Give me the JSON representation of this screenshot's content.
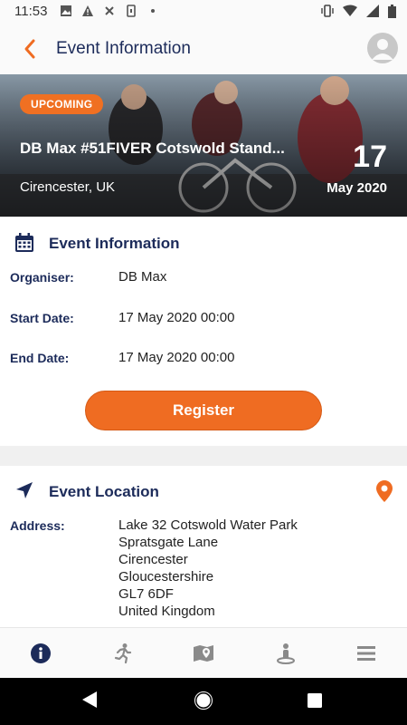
{
  "status_bar": {
    "time": "11:53"
  },
  "app_bar": {
    "title": "Event Information"
  },
  "hero": {
    "badge": "UPCOMING",
    "event_name": "DB Max #51FIVER Cotswold Stand...",
    "location": "Cirencester, UK",
    "day": "17",
    "month_year": "May 2020"
  },
  "event_info": {
    "heading": "Event Information",
    "rows": [
      {
        "label": "Organiser:",
        "value": "DB Max"
      },
      {
        "label": "Start Date:",
        "value": "17 May 2020 00:00"
      },
      {
        "label": "End Date:",
        "value": "17 May 2020 00:00"
      }
    ],
    "register_label": "Register"
  },
  "event_location": {
    "heading": "Event Location",
    "address_label": "Address:",
    "address_lines": [
      "Lake 32 Cotswold Water Park",
      "Spratsgate Lane",
      "Cirencester",
      "Gloucestershire",
      "GL7 6DF",
      "United Kingdom"
    ]
  },
  "colors": {
    "accent": "#ef6c22",
    "navy": "#1c2b5a"
  },
  "bottom_nav": [
    {
      "icon": "info-icon"
    },
    {
      "icon": "runner-icon"
    },
    {
      "icon": "map-icon"
    },
    {
      "icon": "person-location-icon"
    },
    {
      "icon": "menu-icon"
    }
  ]
}
